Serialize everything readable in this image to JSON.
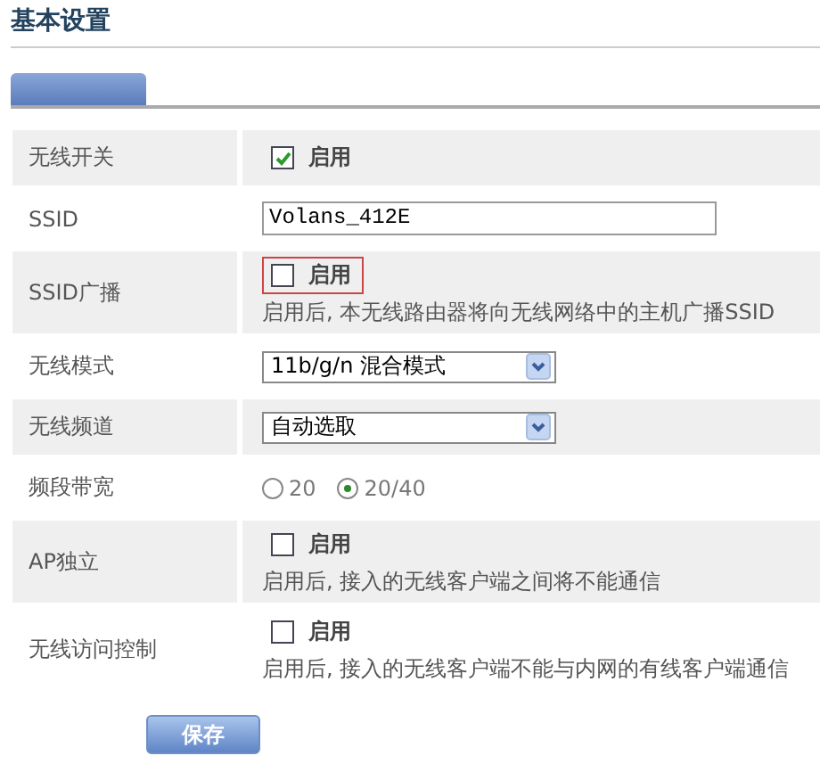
{
  "title": "基本设置",
  "rows": [
    {
      "kind": "checkbox",
      "label": "无线开关",
      "option": "启用",
      "checked": true,
      "highlighted": false
    },
    {
      "kind": "text",
      "label": "SSID",
      "value": "Volans_412E"
    },
    {
      "kind": "checkbox",
      "label": "SSID广播",
      "option": "启用",
      "checked": false,
      "highlighted": true,
      "hint": "启用后, 本无线路由器将向无线网络中的主机广播SSID"
    },
    {
      "kind": "select",
      "label": "无线模式",
      "value": "11b/g/n 混合模式"
    },
    {
      "kind": "select",
      "label": "无线频道",
      "value": "自动选取"
    },
    {
      "kind": "radio",
      "label": "频段带宽",
      "options": [
        {
          "label": "20",
          "selected": false
        },
        {
          "label": "20/40",
          "selected": true
        }
      ]
    },
    {
      "kind": "checkbox",
      "label": "AP独立",
      "option": "启用",
      "checked": false,
      "highlighted": false,
      "hint": "启用后, 接入的无线客户端之间将不能通信"
    },
    {
      "kind": "checkbox",
      "label": "无线访问控制",
      "option": "启用",
      "checked": false,
      "highlighted": false,
      "hint": "启用后, 接入的无线客户端不能与内网的有线客户端通信"
    }
  ],
  "save_button": "保存"
}
